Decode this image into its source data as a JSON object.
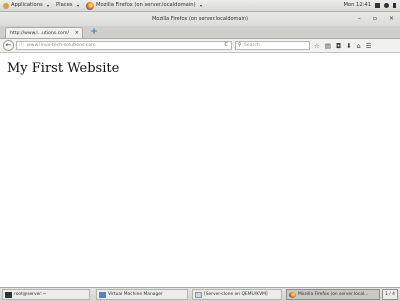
{
  "topbar": {
    "applications_label": "Applications",
    "places_label": "Places",
    "active_app_label": "Mozilla Firefox (on server.localdomain)",
    "clock": "Mon 12:41"
  },
  "window": {
    "title": "Mozilla Firefox (on server.localdomain)",
    "minimize_glyph": "–",
    "maximize_glyph": "▫",
    "close_glyph": "×"
  },
  "tabs": [
    {
      "label": "http://www.l...utions.com/",
      "close_glyph": "×"
    }
  ],
  "new_tab_glyph": "+",
  "navbar": {
    "back_glyph": "←",
    "url": "www.linux-tech-solutions.com",
    "reload_glyph": "C",
    "search_placeholder": "Search"
  },
  "page": {
    "heading": "My First Website"
  },
  "taskbar": {
    "items": [
      {
        "label": "root@server:~",
        "icon": "terminal-icon"
      },
      {
        "label": "Virtual Machine Manager",
        "icon": "virt-manager-icon"
      },
      {
        "label": "[Server-clone on QEMU/KVM]",
        "icon": "vm-window-icon"
      },
      {
        "label": "Mozilla Firefox (on server.local...",
        "icon": "firefox-icon"
      }
    ],
    "workspace": "1 / 4"
  }
}
